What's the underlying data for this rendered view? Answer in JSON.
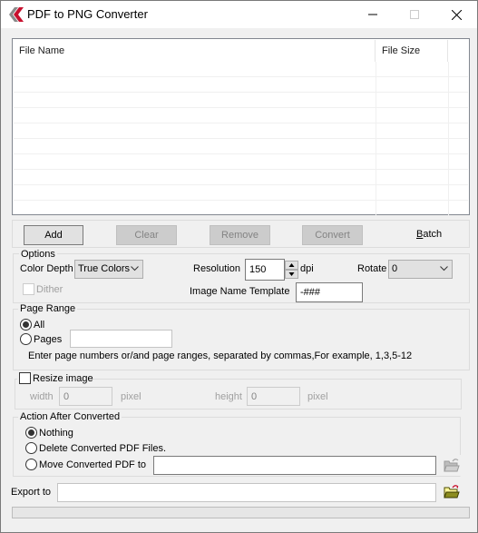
{
  "window": {
    "title": "PDF to PNG Converter",
    "controls": [
      "minimize",
      "maximize",
      "close"
    ]
  },
  "file_list": {
    "columns": [
      "File Name",
      "File Size",
      ""
    ],
    "rows": []
  },
  "toolbar": {
    "add_label": "Add",
    "clear_label": "Clear",
    "remove_label": "Remove",
    "convert_label": "Convert",
    "batch_label": "Batch",
    "batch_mnemonic": "B",
    "batch_rest": "atch"
  },
  "options": {
    "group_label": "Options",
    "color_depth_label": "Color Depth",
    "color_depth_value": "True Colors",
    "resolution_label": "Resolution",
    "resolution_value": "150",
    "resolution_unit": "dpi",
    "rotate_label": "Rotate",
    "rotate_value": "0",
    "dither_label": "Dither",
    "dither_checked": false,
    "name_template_label": "Image Name Template",
    "name_template_value": "-###"
  },
  "page_range": {
    "group_label": "Page Range",
    "all_label": "All",
    "pages_label": "Pages",
    "selected": "All",
    "pages_value": "",
    "hint": "Enter page numbers or/and page ranges, separated by commas,For example, 1,3,5-12"
  },
  "resize": {
    "checkbox_label": "Resize image",
    "checked": false,
    "width_label": "width",
    "width_value": "0",
    "width_unit": "pixel",
    "height_label": "height",
    "height_value": "0",
    "height_unit": "pixel"
  },
  "after_convert": {
    "group_label": "Action After Converted",
    "nothing_label": "Nothing",
    "delete_label": "Delete Converted PDF Files.",
    "move_label": "Move Converted PDF to",
    "selected": "Nothing",
    "move_path": ""
  },
  "export": {
    "label": "Export to",
    "path": ""
  },
  "progress": {
    "percent": 0
  },
  "icons": {
    "app": "red-chevron-logo-icon",
    "move_browse": "folder-open-icon (disabled)",
    "export_browse": "folder-open-icon"
  }
}
